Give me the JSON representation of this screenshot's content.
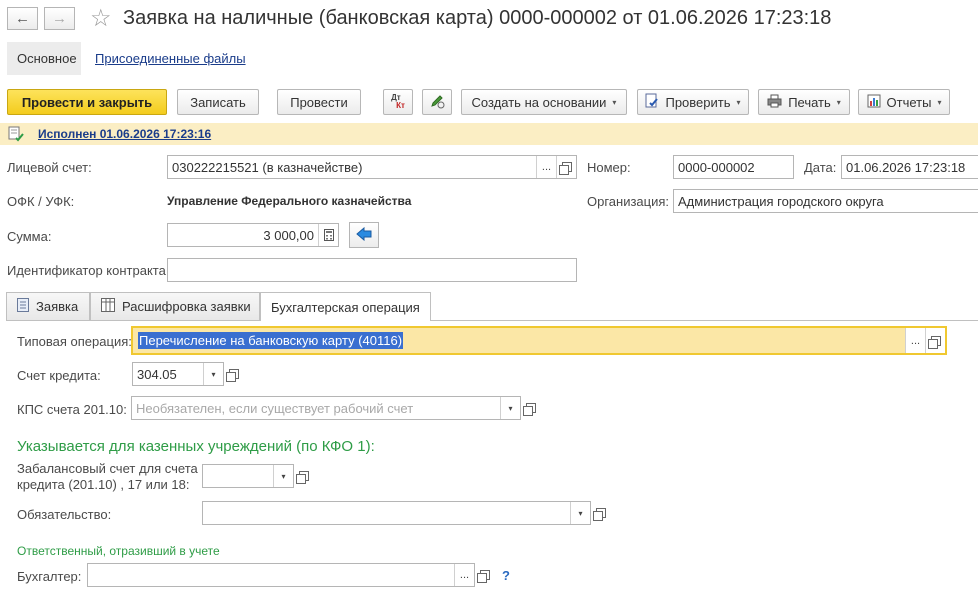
{
  "window": {
    "title": "Заявка на наличные (банковская карта) 0000-000002 от 01.06.2026 17:23:18",
    "back_glyph": "←",
    "forward_glyph": "→",
    "star_glyph": "☆"
  },
  "top_tabs": {
    "main": "Основное",
    "files": "Присоединенные файлы"
  },
  "toolbar": {
    "post_close": "Провести и закрыть",
    "write": "Записать",
    "post": "Провести",
    "dt_kt_top": "Дт",
    "dt_kt_bottom": "Кт",
    "create_based": "Создать на основании",
    "check": "Проверить",
    "print": "Печать",
    "reports": "Отчеты",
    "dropdown_glyph": "▾"
  },
  "status": {
    "text": "Исполнен 01.06.2026 17:23:16",
    "bar_color": "#fbeec4"
  },
  "form": {
    "account_label": "Лицевой счет:",
    "account_value": "030222215521 (в казначействе)",
    "number_label": "Номер:",
    "number_value": "0000-000002",
    "date_label": "Дата:",
    "date_value": "01.06.2026 17:23:18",
    "ofk_label": "ОФК / УФК:",
    "ofk_value": "Управление Федерального казначейства",
    "org_label": "Организация:",
    "org_value": "Администрация городского округа",
    "sum_label": "Сумма:",
    "sum_value": "3 000,00",
    "contract_label": "Идентификатор контракта:",
    "contract_value": "",
    "ellipsis": "..."
  },
  "content_tabs": [
    {
      "label": "Заявка"
    },
    {
      "label": "Расшифровка заявки"
    },
    {
      "label": "Бухгалтерская операция"
    }
  ],
  "operation": {
    "typical_label": "Типовая операция:",
    "typical_value": "Перечисление на банковскую карту (40116)",
    "credit_label": "Счет кредита:",
    "credit_value": "304.05",
    "kps_label": "КПС счета 201.10:",
    "kps_placeholder": "Необязателен, если существует рабочий счет",
    "kfo_heading": "Указывается для казенных учреждений (по КФО 1):",
    "offbalance_label_1": "Забалансовый счет для счета",
    "offbalance_label_2": "кредита (201.10) , 17 или 18:",
    "offbalance_value": "",
    "obligation_label": "Обязательство:",
    "obligation_value": "",
    "responsible_heading": "Ответственный, отразивший в учете",
    "accountant_label": "Бухгалтер:",
    "accountant_value": "",
    "help_glyph": "?"
  },
  "colors": {
    "accent_yellow": "#f8d73c",
    "highlight_yellow": "#fbe7a6",
    "selection_blue": "#3a6fd0",
    "green_text": "#2e9c46",
    "link_blue": "#1a3c8a"
  }
}
